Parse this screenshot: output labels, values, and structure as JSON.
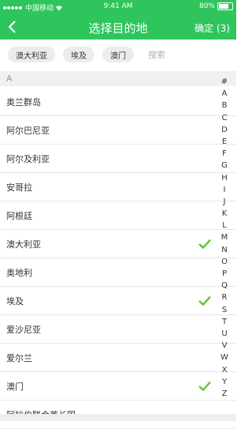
{
  "status": {
    "carrier": "中国移动",
    "time": "9:41 AM",
    "battery": "80%"
  },
  "header": {
    "title": "选择目的地",
    "confirm": "确定 (3)"
  },
  "chips": [
    "澳大利亚",
    "埃及",
    "澳门"
  ],
  "search": {
    "placeholder": "搜索"
  },
  "section": "A",
  "rows": [
    {
      "label": "奥兰群岛",
      "checked": false
    },
    {
      "label": "阿尔巴尼亚",
      "checked": false
    },
    {
      "label": "阿尔及利亚",
      "checked": false
    },
    {
      "label": "安哥拉",
      "checked": false
    },
    {
      "label": "阿根廷",
      "checked": false
    },
    {
      "label": "澳大利亚",
      "checked": true
    },
    {
      "label": "奥地利",
      "checked": false
    },
    {
      "label": "埃及",
      "checked": true
    },
    {
      "label": "爱沙尼亚",
      "checked": false
    },
    {
      "label": "爱尔兰",
      "checked": false
    },
    {
      "label": "澳门",
      "checked": true
    },
    {
      "label": "阿拉伯联合酋长国",
      "checked": false
    }
  ],
  "index": [
    "#",
    "A",
    "B",
    "C",
    "D",
    "E",
    "F",
    "G",
    "H",
    "I",
    "J",
    "K",
    "L",
    "M",
    "N",
    "O",
    "P",
    "Q",
    "R",
    "S",
    "T",
    "U",
    "V",
    "W",
    "X",
    "Y",
    "Z"
  ],
  "colors": {
    "accent": "#2ec55c",
    "check": "#5cc52e"
  }
}
